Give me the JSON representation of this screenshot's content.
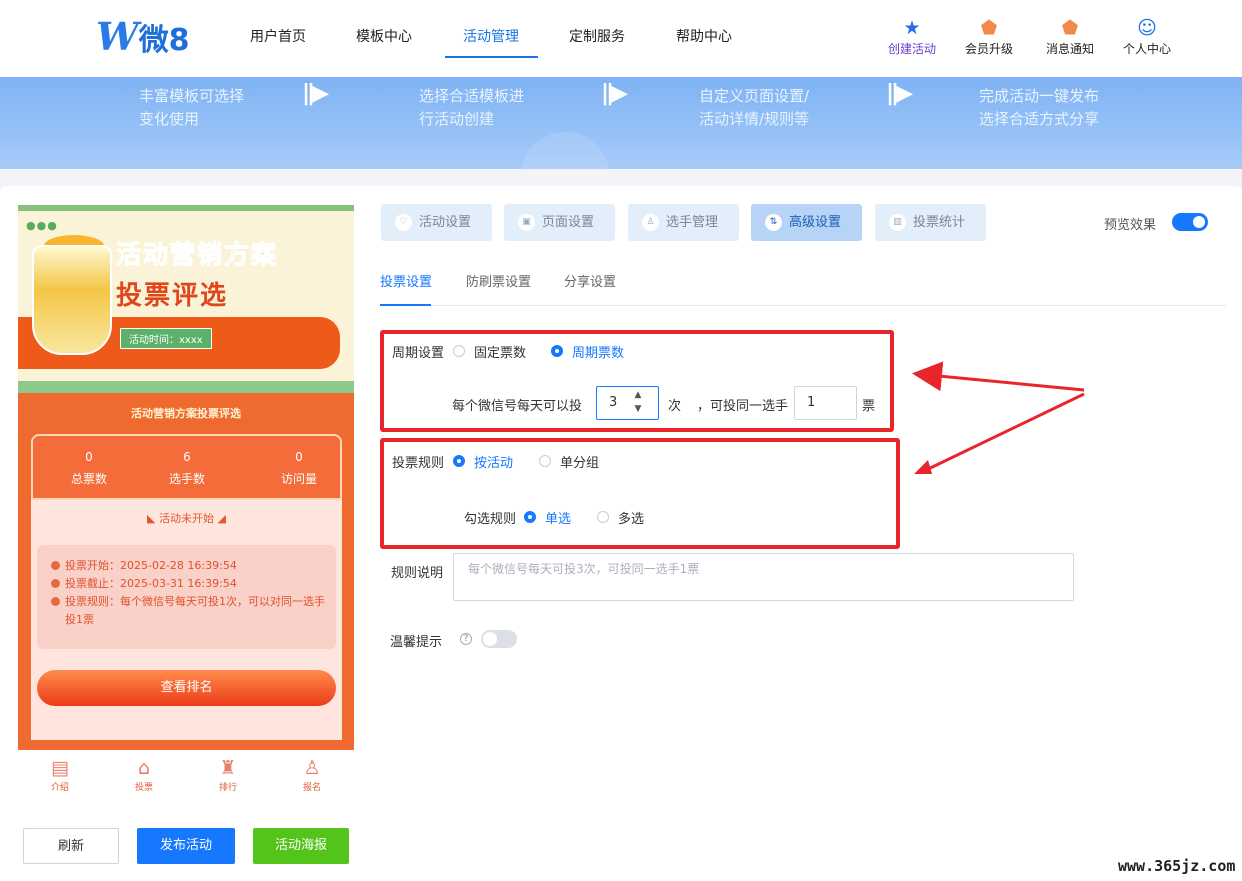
{
  "brand": {
    "logo_w": "W",
    "logo_text": "微8"
  },
  "nav": [
    "用户首页",
    "模板中心",
    "活动管理",
    "定制服务",
    "帮助中心"
  ],
  "tools": [
    {
      "label": "创建活动",
      "icon": "star-icon"
    },
    {
      "label": "会员升级",
      "icon": "vip-icon"
    },
    {
      "label": "消息通知",
      "icon": "bell-icon"
    },
    {
      "label": "个人中心",
      "icon": "user-icon"
    }
  ],
  "steps": [
    "丰富模板可选择\n变化使用",
    "选择合适模板进\n行活动创建",
    "自定义页面设置/\n活动详情/规则等",
    "完成活动一键发布\n选择合适方式分享"
  ],
  "phone": {
    "title1": "活动营销方案",
    "title2": "投票评选",
    "time_tag": "活动时间：xxxx",
    "band_title": "活动营销方案投票评选",
    "stats": [
      {
        "value": "0",
        "label": "总票数"
      },
      {
        "value": "6",
        "label": "选手数"
      },
      {
        "value": "0",
        "label": "访问量"
      }
    ],
    "not_started": "活动未开始",
    "info": [
      "投票开始：2025-02-28 16:39:54",
      "投票截止：2025-03-31 16:39:54",
      "投票规则：每个微信号每天可投1次，可以对同一选手投1票"
    ],
    "rank_button": "查看排名",
    "tabbar": [
      "介绍",
      "投票",
      "排行",
      "报名"
    ]
  },
  "actions": {
    "refresh": "刷新",
    "publish": "发布活动",
    "poster": "活动海报"
  },
  "tabs": [
    "活动设置",
    "页面设置",
    "选手管理",
    "高级设置",
    "投票统计"
  ],
  "preview_label": "预览效果",
  "preview_on": true,
  "subtabs": [
    "投票设置",
    "防刷票设置",
    "分享设置"
  ],
  "period": {
    "label": "周期设置",
    "options": [
      "固定票数",
      "周期票数"
    ],
    "selected": "周期票数",
    "sentence_pre": "每个微信号每天可以投",
    "per_day_value": "3",
    "unit_times": "次",
    "sentence_mid": "，可投同一选手",
    "per_player_value": "1",
    "unit_votes": "票"
  },
  "rule": {
    "label": "投票规则",
    "options": [
      "按活动",
      "单分组"
    ],
    "selected": "按活动",
    "check_label": "勾选规则",
    "check_options": [
      "单选",
      "多选"
    ],
    "check_selected": "单选"
  },
  "desc": {
    "label": "规则说明",
    "placeholder": "每个微信号每天可投3次，可投同一选手1票"
  },
  "tip": {
    "label": "温馨提示",
    "enabled": false
  },
  "watermark": "www.365jz.com"
}
